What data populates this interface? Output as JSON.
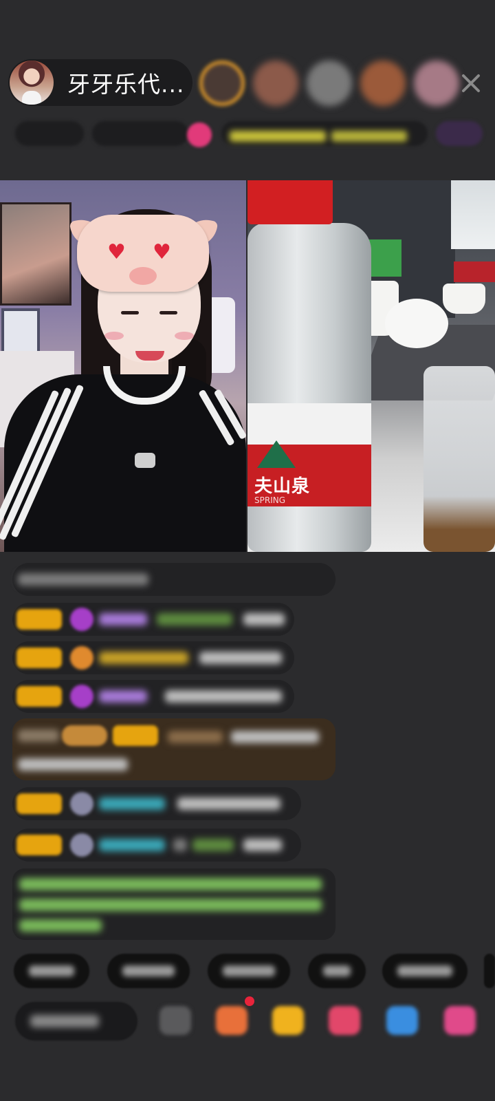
{
  "header": {
    "host_name": "牙牙乐代...",
    "viewer_avatars": [
      "viewer-1",
      "viewer-2",
      "viewer-3",
      "viewer-4",
      "viewer-5"
    ],
    "close_icon": "close-icon"
  },
  "video": {
    "left_stream": "streamer-camera",
    "right_stream": "table-camera",
    "bottle_label": "夫山泉",
    "bottle_label_sub": "SPRING"
  },
  "colors": {
    "background": "#2b2b2d",
    "pill": "#1c1c1e",
    "badge_gold": "#e6a40f",
    "username_purple": "#a77ad8",
    "username_yellow": "#c8a227",
    "username_cyan": "#3aa6b6",
    "system_green": "#79b95a",
    "highlight_row": "#3b2d1e"
  },
  "bottom_actions": {
    "icons": [
      "emoji-icon",
      "gift-box-icon",
      "gift-icon",
      "heart-gift-icon",
      "mask-gift-icon",
      "more-gift-icon"
    ]
  }
}
